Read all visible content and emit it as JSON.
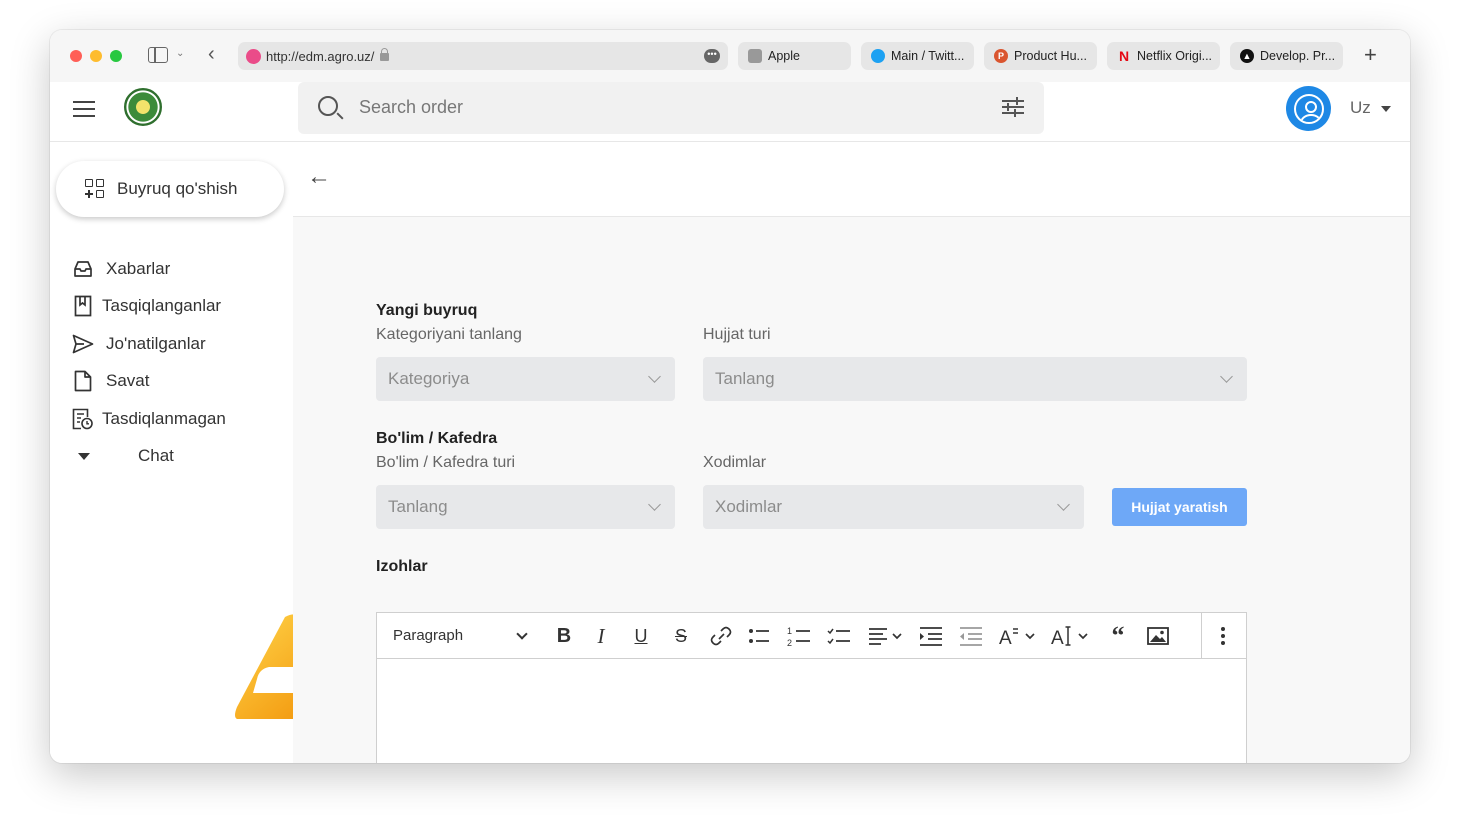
{
  "browser": {
    "url": "http://edm.agro.uz/",
    "tabs": [
      {
        "label": "Apple",
        "icon": "apple-icon"
      },
      {
        "label": "Main / Twitt...",
        "icon": "twitter-icon"
      },
      {
        "label": "Product Hu...",
        "icon": "product-hunt-icon"
      },
      {
        "label": "Netflix Origi...",
        "icon": "netflix-icon"
      },
      {
        "label": "Develop. Pr...",
        "icon": "vercel-icon"
      }
    ],
    "new_tab": "+"
  },
  "header": {
    "search_placeholder": "Search order",
    "language": "Uz"
  },
  "sidebar": {
    "compose_label": "Buyruq qo'shish",
    "items": [
      {
        "label": "Xabarlar",
        "icon": "inbox-icon"
      },
      {
        "label": "Tasqiqlanganlar",
        "icon": "bookmark-icon"
      },
      {
        "label": "Jo'natilganlar",
        "icon": "send-icon"
      },
      {
        "label": "Savat",
        "icon": "file-icon"
      },
      {
        "label": "Tasdiqlanmagan",
        "icon": "pending-doc-icon"
      },
      {
        "label": "Chat",
        "icon": "caret-down-icon"
      }
    ]
  },
  "form": {
    "section1_title": "Yangi buyruq",
    "category_label": "Kategoriyani tanlang",
    "category_value": "Kategoriya",
    "doc_type_label": "Hujjat turi",
    "doc_type_value": "Tanlang",
    "section2_title": "Bo'lim / Kafedra",
    "dept_label": "Bo'lim / Kafedra turi",
    "dept_value": "Tanlang",
    "staff_label": "Xodimlar",
    "staff_value": "Xodimlar",
    "create_button": "Hujjat yaratish",
    "notes_title": "Izohlar"
  },
  "editor": {
    "paragraph_select": "Paragraph",
    "tools": [
      "bold",
      "italic",
      "underline",
      "strikethrough",
      "link",
      "bulleted-list",
      "numbered-list",
      "todo-list",
      "alignment",
      "indent",
      "outdent",
      "font-size",
      "font-family",
      "block-quote",
      "image",
      "more"
    ]
  },
  "colors": {
    "accent": "#1e88e5",
    "button": "#6ea8f7",
    "select_bg": "#e7e8ea",
    "brand_logo": "#f5a800"
  }
}
